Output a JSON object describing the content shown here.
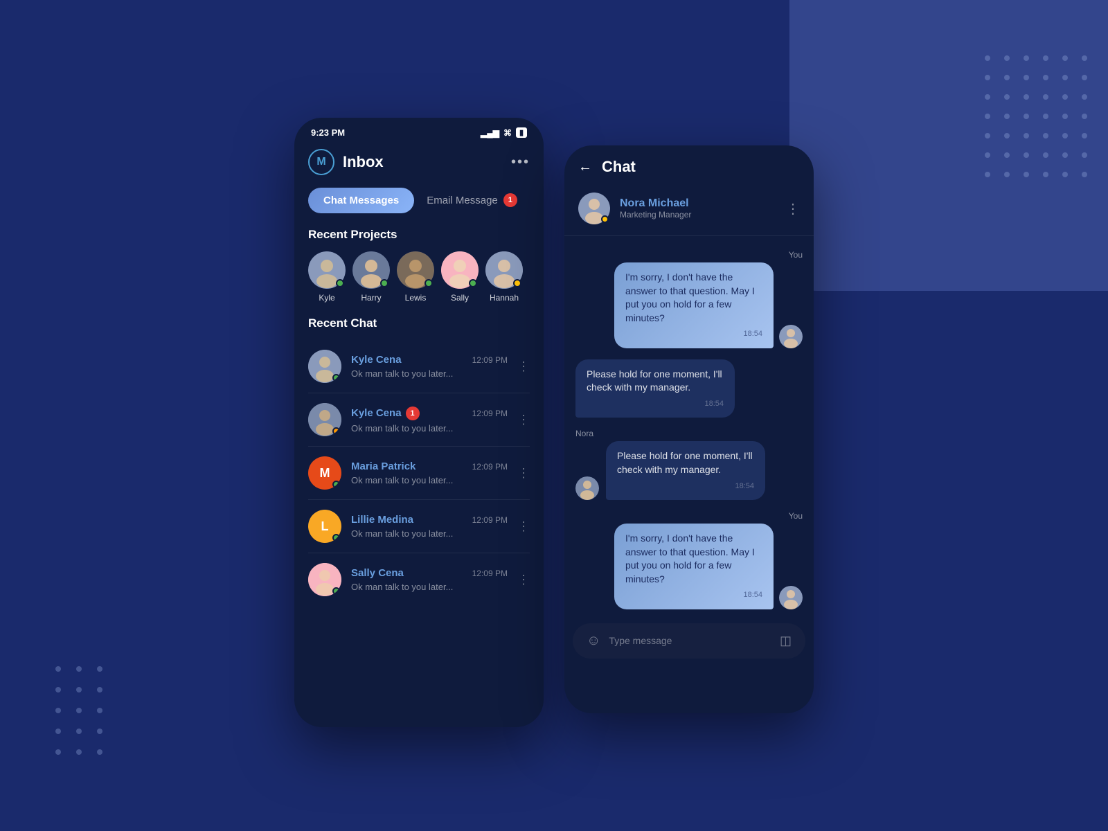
{
  "background": {
    "color": "#1a2a6c"
  },
  "status_bar": {
    "time": "9:23 PM",
    "signal": "▂▄▆",
    "wifi": "wifi",
    "battery": "battery"
  },
  "inbox_screen": {
    "logo": "M",
    "title": "Inbox",
    "more_menu": "•••",
    "tabs": {
      "active": "Chat Messages",
      "inactive": "Email Message",
      "badge": "1"
    },
    "recent_projects": {
      "label": "Recent Projects",
      "contacts": [
        {
          "name": "Kyle",
          "status": "green"
        },
        {
          "name": "Harry",
          "status": "green"
        },
        {
          "name": "Lewis",
          "status": "green"
        },
        {
          "name": "Sally",
          "status": "green"
        },
        {
          "name": "Hannah",
          "status": "yellow"
        }
      ]
    },
    "recent_chat": {
      "label": "Recent Chat",
      "items": [
        {
          "name": "Kyle Cena",
          "time": "12:09 PM",
          "preview": "Ok man talk to you later...",
          "badge": null
        },
        {
          "name": "Kyle Cena",
          "time": "12:09 PM",
          "preview": "Ok man talk to you later...",
          "badge": "1"
        },
        {
          "name": "Maria Patrick",
          "time": "12:09 PM",
          "preview": "Ok man talk to you later...",
          "badge": null,
          "initial": "M",
          "color": "orange"
        },
        {
          "name": "Lillie Medina",
          "time": "12:09 PM",
          "preview": "Ok man talk to you later...",
          "badge": null,
          "initial": "L",
          "color": "yellow"
        },
        {
          "name": "Sally Cena",
          "time": "12:09 PM",
          "preview": "Ok man talk to you later...",
          "badge": null
        }
      ]
    }
  },
  "chat_screen": {
    "back_label": "←",
    "title": "Chat",
    "more_menu": "⋮",
    "contact": {
      "name": "Nora Michael",
      "role": "Marketing Manager",
      "status": "online"
    },
    "messages": [
      {
        "sender": "You",
        "side": "right",
        "text": "I'm sorry, I don't have the answer to that question. May I put you on hold for a few minutes?",
        "time": "18:54"
      },
      {
        "sender": "",
        "side": "left",
        "text": "Please hold for one moment, I'll check with my manager.",
        "time": "18:54"
      },
      {
        "sender": "Nora",
        "side": "left",
        "text": "Please hold for one moment, I'll check with my manager.",
        "time": "18:54"
      },
      {
        "sender": "You",
        "side": "right",
        "text": "I'm sorry, I don't have the answer to that question. May I put you on hold for a few minutes?",
        "time": "18:54"
      }
    ],
    "input_placeholder": "Type message"
  }
}
